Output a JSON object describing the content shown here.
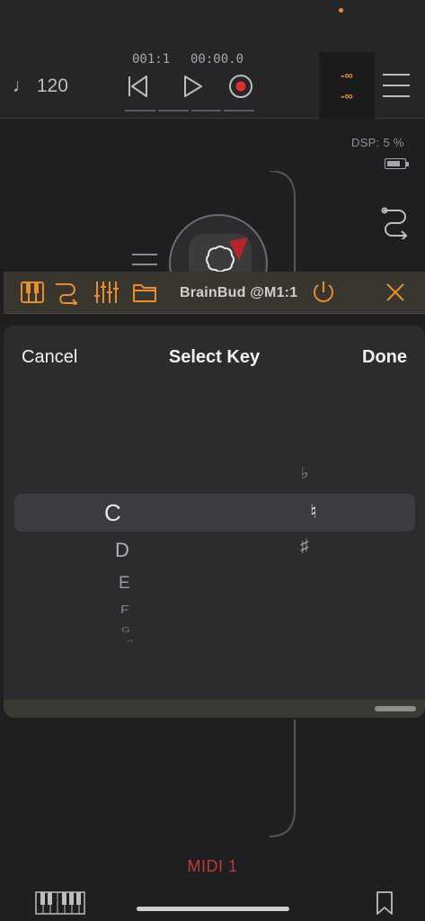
{
  "transport": {
    "tempo": "♩ 120",
    "bar_position": "001:1",
    "time": "00:00.0",
    "meter_left": "-∞",
    "meter_right": "-∞"
  },
  "status": {
    "dsp_label": "DSP:",
    "dsp_value": "5 %",
    "battery_level": 0.8
  },
  "plugin_bar": {
    "title": "BrainBud @M1:1"
  },
  "picker": {
    "cancel_label": "Cancel",
    "title": "Select Key",
    "done_label": "Done",
    "note_wheel": [
      "C",
      "D",
      "E",
      "F",
      "G",
      "A"
    ],
    "selected_note": "C",
    "accidental_wheel": [
      "♭",
      "♮",
      "♯"
    ],
    "selected_accidental": "♮"
  },
  "midi_label": "MIDI 1",
  "colors": {
    "accent": "#e88c2c",
    "midi_red": "#c2383a",
    "record_red": "#e02c2c"
  }
}
